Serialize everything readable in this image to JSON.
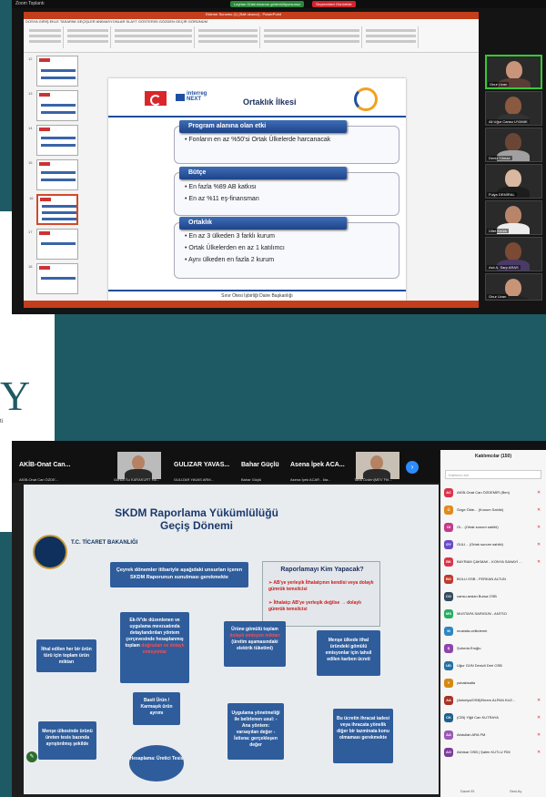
{
  "top": {
    "app_title": "Zoom Toplantı",
    "banner_left": "Leyhan Gülal ekranını görüntülüyorsunuz",
    "banner_right": "Seçenekleri Görüntüle",
    "ribbon_tabs": "DOSYA  GİRİŞ  EKLE  TASARIM  GEÇİŞLER  ANİMASYONLAR  SLAYT GÖSTERİSİ  GÖZDEN GEÇİR  GÖRÜNÜM",
    "doc_title": "Ekleme Sunumu (1) [Salt okunur] - PowerPoint",
    "thumb_numbers": [
      "12",
      "13",
      "14",
      "15",
      "16",
      "17",
      "18"
    ],
    "gallery": [
      "Onur Uzan",
      "Ali Uğur Cansu UYANIK",
      "Deniz Yılmaz",
      "Fulya DEMİRAL",
      "Ülfet Ertürk",
      "Aslı A. Sarp ARAS",
      "Onur Uzan"
    ],
    "notes": "Not eklemek için tıklatın"
  },
  "slide1": {
    "title": "Ortaklık İlkesi",
    "interreg": "interreg",
    "next": "NEXT",
    "sections": [
      {
        "header": "Program alanına olan etki",
        "bullets": [
          "Fonların en az %50'si Ortak Ülkelerde harcanacak"
        ]
      },
      {
        "header": "Bütçe",
        "bullets": [
          "En fazla %89 AB katkısı",
          "En az  %11 eş-finansman"
        ]
      },
      {
        "header": "Ortaklık",
        "bullets": [
          "En az 3 ülkeden 3 farklı kurum",
          "Ortak Ülkelerden en az 1 katılımcı",
          "Aynı ülkeden en fazla 2 kurum"
        ]
      }
    ],
    "footer": "Sınır Ötesi İşbirliği Daire Başkanlığı"
  },
  "left": {
    "big_letter": "Y",
    "small_text": "ti"
  },
  "bottom": {
    "speakers": [
      {
        "label": "AKİB-Onat Can...",
        "caption": "AKİB-Onat Can ÖZDE..."
      },
      {
        "label": "",
        "caption": "Gonca Su KARAKURT Ha..."
      },
      {
        "label": "GULIZAR YAVAS...",
        "caption": "GULIZAR YAVAS ARM..."
      },
      {
        "label": "Bahar Güçlü",
        "caption": "Bahar Güçlü"
      },
      {
        "label": "Asena İpek ACA...",
        "caption": "Asena İpek ACAR - İda..."
      },
      {
        "label": "",
        "caption": "Taha Özden(MEV Fbt..."
      }
    ],
    "next_arrow": "›"
  },
  "slide2": {
    "title": "SKDM Raporlama Yükümlülüğü Geçiş Dönemi",
    "ministry": "T.C. TİCARET BAKANLIĞI",
    "intro": "Çeyrek dönemler itibariyle aşağıdaki unsurları içeren SKDM Raporunun sunulması gerekmekte",
    "report_title": "Raporlamayı Kim Yapacak?",
    "report_items": [
      "AB'ye yerleşik İthalatçının kendisi veya dolaylı gümrük temsilcisi",
      "İthalatçı AB'ye yerleşik değilse → dolaylı gümrük temsilcisi"
    ],
    "box1": "İthal edilen her bir ürün türü için toplam ürün miktarı",
    "box1b": "Menşe ülkesinde ürünü üreten tesis bazında ayrıştırılmış şekilde",
    "box2": "Ek-IV'de düzenlenen ve uygulama mevzuatında detaylandırılan yöntem çerçevesinde hesaplanmış toplam",
    "box2_red": "doğrudan ve dolaylı emisyonlar",
    "box2b": "Basit Ürün / Karmaşık ürün ayrımı",
    "box2c": "Hesaplama: Üretici Tesis",
    "box3": "Ürüne gömülü toplam",
    "box3_red": "dolaylı emisyon miktarı",
    "box3_tail": "(üretim aşamasındaki elektrik tüketimi)",
    "box3b": "Uygulama yönetmeliği ile belirlenen usul: - Ana yöntem: varsayılan değer - İstisna: gerçekleşen değer",
    "box4": "Menşe ülkede ithal üründeki gömülü emisyonlar için tahsil edilen karbon ücreti",
    "box4b": "Bu ücretin ihracat iadesi veya ihracata yönelik diğer bir tazminata konu olmaması gerekmekte"
  },
  "chat": {
    "header": "Katılımcılar (150)",
    "search": "Katılımcı bul",
    "participants": [
      {
        "initials": "AC",
        "name": "AKİB-Onat Can ÖZDEMİR (Ben)",
        "color": "#d9344a"
      },
      {
        "initials": "Ö",
        "name": "Özge Ökte... (Konum Sahibi)",
        "color": "#e08a1e"
      },
      {
        "initials": "Ol",
        "name": "Ol... (Ortak sunum sahibi)",
        "color": "#c53a8a"
      },
      {
        "initials": "GY",
        "name": "GULI... (Ortak sunum sahibi)",
        "color": "#6a4bc8"
      },
      {
        "initials": "BK",
        "name": "BAYRAM ÇAKMAK - KONYA SANAYİ ...",
        "color": "#d9344a"
      },
      {
        "initials": "BO",
        "name": "BOLU OSB - FERKAN ALTUN",
        "color": "#c0392b"
      },
      {
        "initials": "CO",
        "name": "cansu.arslan Bursa OSB",
        "color": "#34495e"
      },
      {
        "initials": "MS",
        "name": "MUSTAFA SARIGÜN - ANTSO",
        "color": "#27ae60"
      },
      {
        "initials": "M",
        "name": "mustafa.celikdemir",
        "color": "#2e86c1"
      },
      {
        "initials": "Ş",
        "name": "Şuheda Eroğlu",
        "color": "#8e44ad"
      },
      {
        "initials": "UD",
        "name": "Uğur GÜN Denizli Deri OSB",
        "color": "#2471a3"
      },
      {
        "initials": "Y",
        "name": "yubakisalta",
        "color": "#d68910"
      },
      {
        "initials": "AA",
        "name": "(Ankelya/OSB)Ekrem ALPAN KUZ...",
        "color": "#a93226"
      },
      {
        "initials": "CK",
        "name": "(CİB) Yiğit Can KUTRAYA",
        "color": "#1f618d"
      },
      {
        "initials": "AA",
        "name": "Abdullah ARA FM",
        "color": "#9b59b6"
      },
      {
        "initials": "AO",
        "name": "Akhisar OSB | Şahin KUTLU FİM",
        "color": "#7d3c98"
      }
    ],
    "footer_left": "Davet Et",
    "footer_right": "Sesi Aç"
  }
}
